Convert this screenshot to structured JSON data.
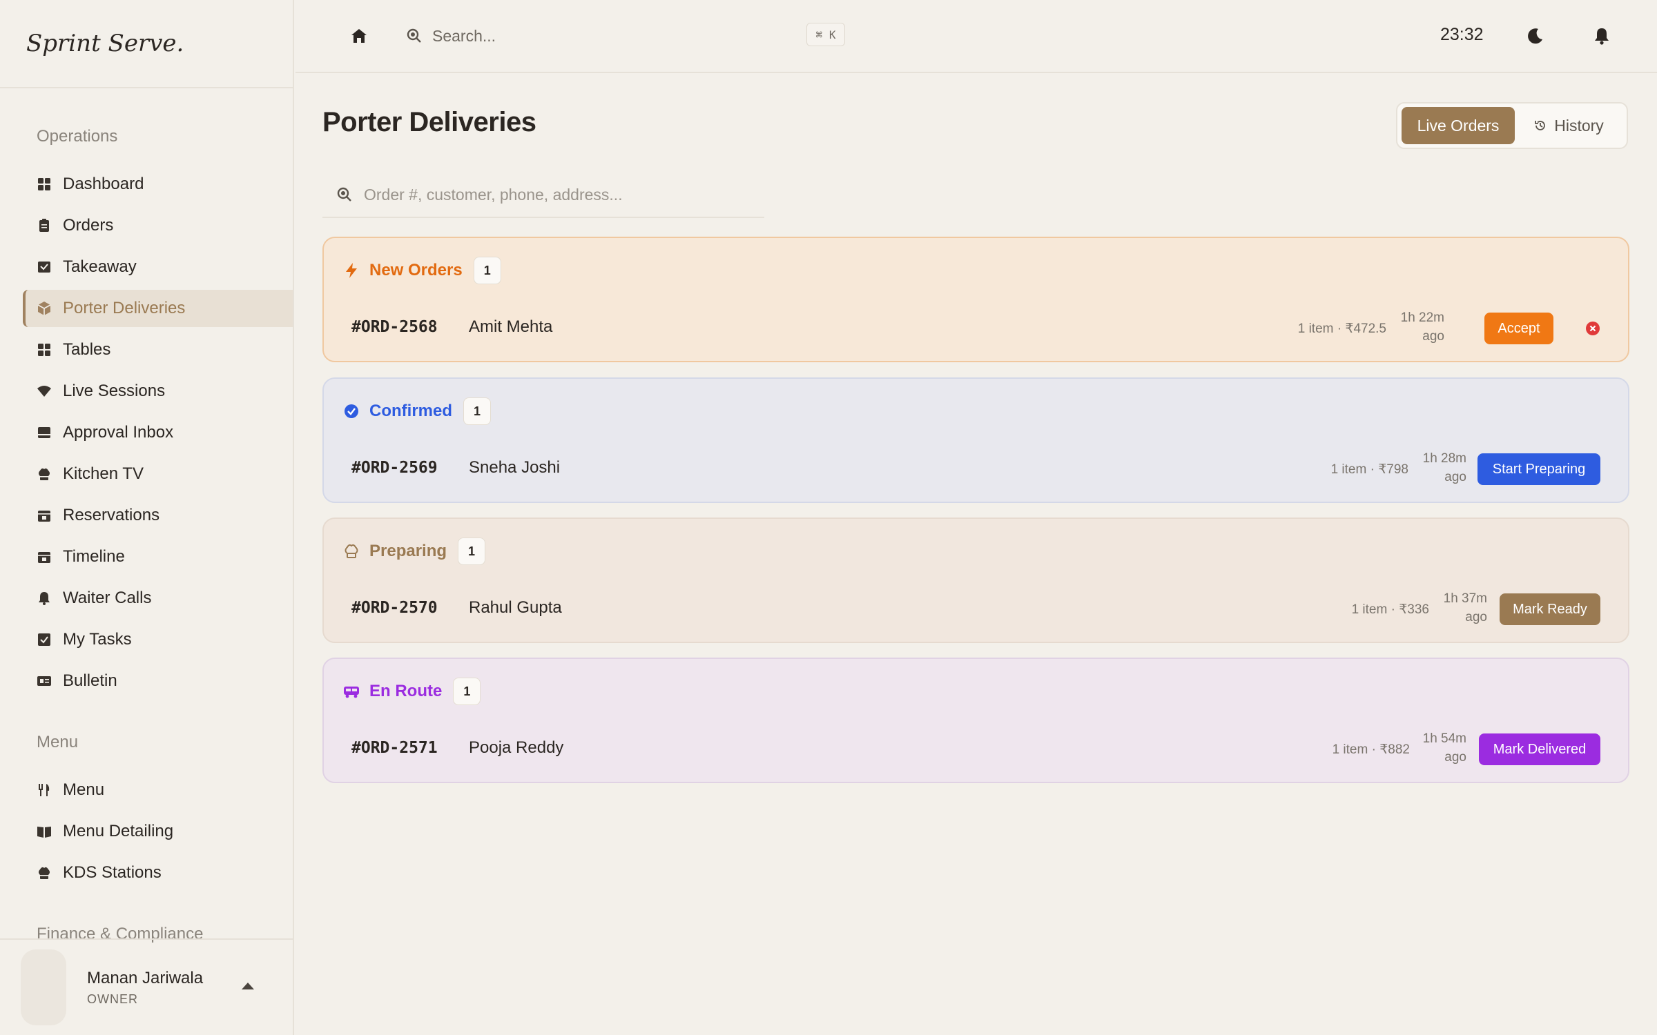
{
  "brand": "Sprint Serve.",
  "sidebar": {
    "sections": [
      {
        "title": "Operations",
        "items": [
          {
            "label": "Dashboard",
            "icon": "grid-icon"
          },
          {
            "label": "Orders",
            "icon": "clipboard-icon"
          },
          {
            "label": "Takeaway",
            "icon": "takeaway-icon"
          },
          {
            "label": "Porter Deliveries",
            "icon": "package-icon",
            "active": true
          },
          {
            "label": "Tables",
            "icon": "grid-icon"
          },
          {
            "label": "Live Sessions",
            "icon": "wifi-icon"
          },
          {
            "label": "Approval Inbox",
            "icon": "inbox-icon"
          },
          {
            "label": "Kitchen TV",
            "icon": "chef-hat-icon"
          },
          {
            "label": "Reservations",
            "icon": "calendar-icon"
          },
          {
            "label": "Timeline",
            "icon": "calendar-icon"
          },
          {
            "label": "Waiter Calls",
            "icon": "bell-icon"
          },
          {
            "label": "My Tasks",
            "icon": "checkbox-icon"
          },
          {
            "label": "Bulletin",
            "icon": "newspaper-icon"
          }
        ]
      },
      {
        "title": "Menu",
        "items": [
          {
            "label": "Menu",
            "icon": "utensils-icon"
          },
          {
            "label": "Menu Detailing",
            "icon": "book-icon"
          },
          {
            "label": "KDS Stations",
            "icon": "chef-hat-icon"
          }
        ]
      },
      {
        "title": "Finance & Compliance",
        "items": []
      }
    ],
    "user": {
      "name": "Manan Jariwala",
      "role": "OWNER"
    }
  },
  "topbar": {
    "search_placeholder": "Search...",
    "shortcut": "⌘ K",
    "time": "23:32"
  },
  "page": {
    "title": "Porter Deliveries",
    "tabs": {
      "live": "Live Orders",
      "history": "History"
    },
    "order_search_placeholder": "Order #, customer, phone, address..."
  },
  "groups": {
    "new": {
      "title": "New Orders",
      "count": "1",
      "order": {
        "id": "#ORD-2568",
        "customer": "Amit Mehta",
        "meta": "1 item · ₹472.5",
        "age_line1": "1h 22m",
        "age_line2": "ago",
        "action": "Accept"
      }
    },
    "confirmed": {
      "title": "Confirmed",
      "count": "1",
      "order": {
        "id": "#ORD-2569",
        "customer": "Sneha Joshi",
        "meta": "1 item · ₹798",
        "age_line1": "1h 28m",
        "age_line2": "ago",
        "action": "Start Preparing"
      }
    },
    "preparing": {
      "title": "Preparing",
      "count": "1",
      "order": {
        "id": "#ORD-2570",
        "customer": "Rahul Gupta",
        "meta": "1 item · ₹336",
        "age_line1": "1h 37m",
        "age_line2": "ago",
        "action": "Mark Ready"
      }
    },
    "enroute": {
      "title": "En Route",
      "count": "1",
      "order": {
        "id": "#ORD-2571",
        "customer": "Pooja Reddy",
        "meta": "1 item · ₹882",
        "age_line1": "1h 54m",
        "age_line2": "ago",
        "action": "Mark Delivered"
      }
    }
  },
  "colors": {
    "accent": "#9a7a52",
    "new": "#e26a10",
    "confirmed": "#2e5ce0",
    "enroute": "#9b2ce0",
    "reject": "#e03a3a"
  }
}
